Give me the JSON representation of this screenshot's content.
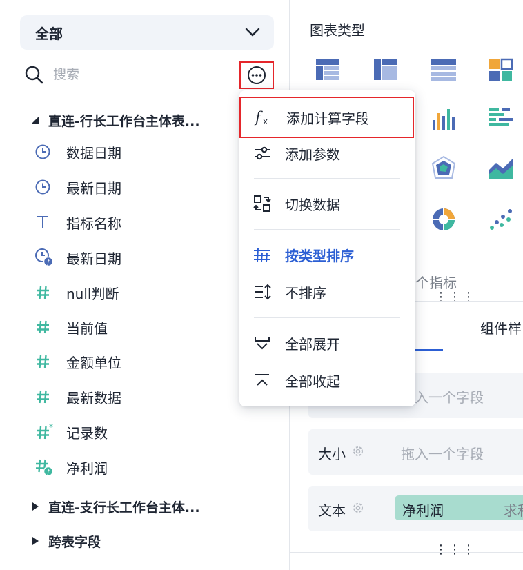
{
  "left_panel": {
    "scope_select": {
      "value": "全部"
    },
    "search": {
      "placeholder": "搜索"
    },
    "tables": [
      {
        "name": "直连-行长工作台主体表...",
        "expanded": true,
        "fields": [
          {
            "label": "数据日期",
            "type_icon": "clock-icon"
          },
          {
            "label": "最新日期",
            "type_icon": "clock-icon"
          },
          {
            "label": "指标名称",
            "type_icon": "text-type-icon"
          },
          {
            "label": "最新日期",
            "type_icon": "clock-formula-icon"
          },
          {
            "label": "null判断",
            "type_icon": "number-type-icon"
          },
          {
            "label": "当前值",
            "type_icon": "number-type-icon"
          },
          {
            "label": "金额单位",
            "type_icon": "number-type-icon"
          },
          {
            "label": "最新数据",
            "type_icon": "number-type-icon"
          },
          {
            "label": "记录数",
            "type_icon": "number-star-icon"
          },
          {
            "label": "净利润",
            "type_icon": "number-formula-icon"
          }
        ]
      },
      {
        "name": "直连-支行长工作台主体...",
        "expanded": false
      },
      {
        "name": "跨表字段",
        "expanded": false
      }
    ]
  },
  "more_menu": {
    "items": [
      {
        "label": "添加计算字段",
        "icon": "fx-icon"
      },
      {
        "label": "添加参数",
        "icon": "sliders-icon"
      },
      {
        "label": "切换数据",
        "icon": "switch-data-icon"
      },
      {
        "label": "按类型排序",
        "icon": "sort-by-type-icon",
        "active": true
      },
      {
        "label": "不排序",
        "icon": "no-sort-icon"
      },
      {
        "label": "全部展开",
        "icon": "expand-all-icon"
      },
      {
        "label": "全部收起",
        "icon": "collapse-all-icon"
      }
    ]
  },
  "right_panel": {
    "chart_type_title": "图表类型",
    "indicator_label": "个指标",
    "tab_partial": "组件样",
    "rows": [
      {
        "label": "",
        "placeholder": "拖入一个字段"
      },
      {
        "label": "大小",
        "placeholder": "拖入一个字段"
      },
      {
        "label": "文本",
        "chip": "净利润",
        "chip_suffix": "求和"
      }
    ]
  },
  "colors": {
    "accent": "#2c5fd4",
    "highlight_border": "#e5262b",
    "field_number": "#3fb8a0",
    "field_time": "#4b6bb5"
  }
}
